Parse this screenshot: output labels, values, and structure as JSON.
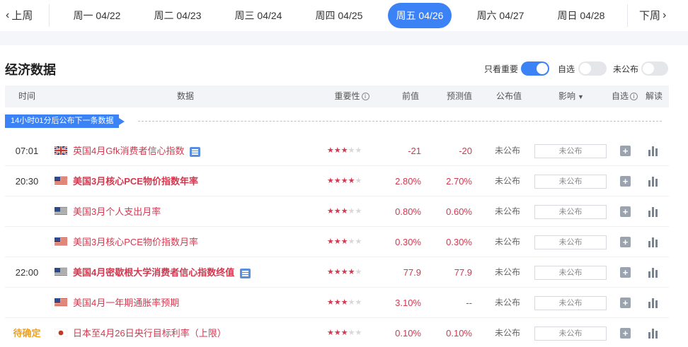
{
  "weekbar": {
    "prev_label": "上周",
    "next_label": "下周",
    "days": [
      {
        "label": "周一 04/22",
        "active": false
      },
      {
        "label": "周二 04/23",
        "active": false
      },
      {
        "label": "周三 04/24",
        "active": false
      },
      {
        "label": "周四 04/25",
        "active": false
      },
      {
        "label": "周五 04/26",
        "active": true
      },
      {
        "label": "周六 04/27",
        "active": false
      },
      {
        "label": "周日 04/28",
        "active": false
      }
    ]
  },
  "section": {
    "title": "经济数据",
    "filters": {
      "important_label": "只看重要",
      "important_on": true,
      "watchlist_label": "自选",
      "watchlist_on": false,
      "unpublished_label": "未公布",
      "unpublished_on": false
    }
  },
  "table": {
    "headers": {
      "time": "时间",
      "data": "数据",
      "importance": "重要性",
      "previous": "前值",
      "forecast": "预测值",
      "actual": "公布值",
      "impact": "影响",
      "watch": "自选",
      "explain": "解读"
    },
    "countdown": "14小时01分后公布下一条数据",
    "rows": [
      {
        "time": "07:01",
        "flag": "uk",
        "name": "英国4月Gfk消费者信心指数",
        "stars": 3,
        "prev": "-21",
        "forecast": "-20",
        "actual": "未公布",
        "impact": "未公布",
        "bold": false,
        "doc": true
      },
      {
        "time": "20:30",
        "flag": "us",
        "name": "美国3月核心PCE物价指数年率",
        "stars": 4,
        "prev": "2.80%",
        "forecast": "2.70%",
        "actual": "未公布",
        "impact": "未公布",
        "bold": true,
        "doc": false
      },
      {
        "time": "",
        "flag": "us",
        "name": "美国3月个人支出月率",
        "stars": 3,
        "prev": "0.80%",
        "forecast": "0.60%",
        "actual": "未公布",
        "impact": "未公布",
        "bold": false,
        "doc": false
      },
      {
        "time": "",
        "flag": "us",
        "name": "美国3月核心PCE物价指数月率",
        "stars": 3,
        "prev": "0.30%",
        "forecast": "0.30%",
        "actual": "未公布",
        "impact": "未公布",
        "bold": false,
        "doc": false
      },
      {
        "time": "22:00",
        "flag": "us",
        "name": "美国4月密歇根大学消费者信心指数终值",
        "stars": 4,
        "prev": "77.9",
        "forecast": "77.9",
        "actual": "未公布",
        "impact": "未公布",
        "bold": true,
        "doc": true
      },
      {
        "time": "",
        "flag": "us",
        "name": "美国4月一年期通胀率预期",
        "stars": 3,
        "prev": "3.10%",
        "forecast": "--",
        "actual": "未公布",
        "impact": "未公布",
        "bold": false,
        "doc": false
      },
      {
        "time": "待确定",
        "flag": "jp",
        "name": "日本至4月26日央行目标利率（上限）",
        "stars": 3,
        "prev": "0.10%",
        "forecast": "0.10%",
        "actual": "未公布",
        "impact": "未公布",
        "bold": false,
        "doc": false
      }
    ]
  },
  "colors": {
    "accent": "#3b82f6",
    "highlight_red": "#d4384f",
    "pending_orange": "#f0a020"
  }
}
